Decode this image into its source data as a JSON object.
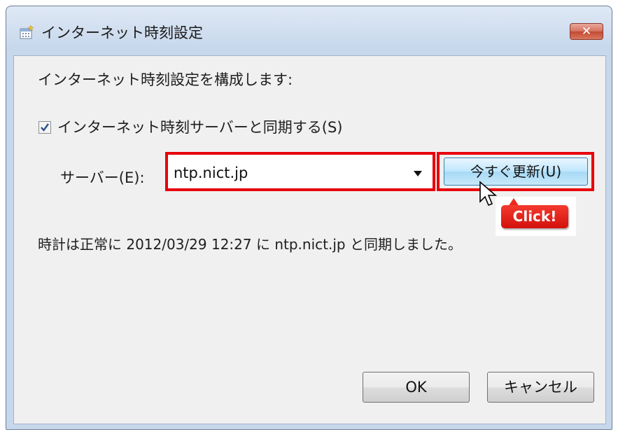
{
  "window": {
    "title": "インターネット時刻設定",
    "close_label": "✕"
  },
  "content": {
    "heading": "インターネット時刻設定を構成します:",
    "sync_checkbox": {
      "checked": true,
      "label": "インターネット時刻サーバーと同期する(S)"
    },
    "server": {
      "label": "サーバー(E):",
      "value": "ntp.nict.jp"
    },
    "update_button": "今すぐ更新(U)",
    "status_text": "時計は正常に 2012/03/29 12:27 に ntp.nict.jp と同期しました。"
  },
  "annotation": {
    "click_label": "Click!",
    "highlight_color": "#e8000b"
  },
  "buttons": {
    "ok": "OK",
    "cancel": "キャンセル"
  }
}
